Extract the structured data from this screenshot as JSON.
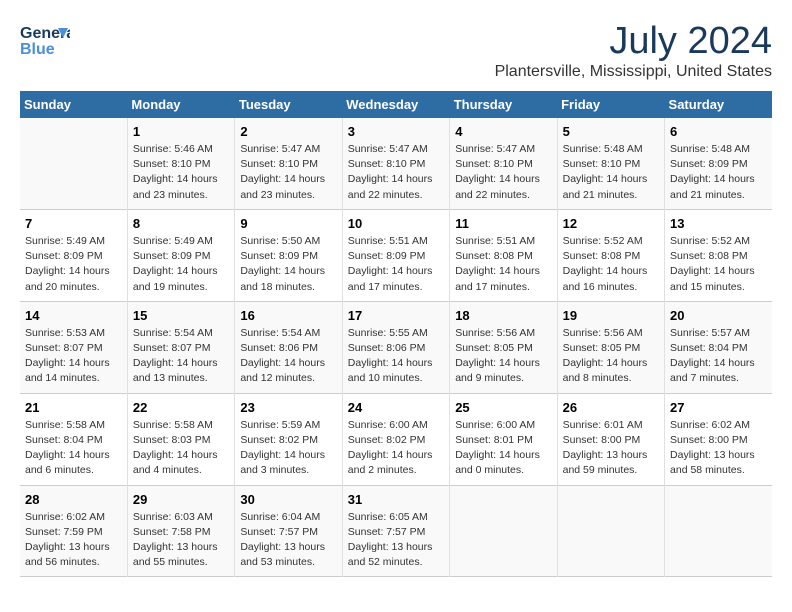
{
  "header": {
    "logo_line1": "General",
    "logo_line2": "Blue",
    "title": "July 2024",
    "subtitle": "Plantersville, Mississippi, United States"
  },
  "days_of_week": [
    "Sunday",
    "Monday",
    "Tuesday",
    "Wednesday",
    "Thursday",
    "Friday",
    "Saturday"
  ],
  "weeks": [
    [
      {
        "day": "",
        "content": ""
      },
      {
        "day": "1",
        "content": "Sunrise: 5:46 AM\nSunset: 8:10 PM\nDaylight: 14 hours\nand 23 minutes."
      },
      {
        "day": "2",
        "content": "Sunrise: 5:47 AM\nSunset: 8:10 PM\nDaylight: 14 hours\nand 23 minutes."
      },
      {
        "day": "3",
        "content": "Sunrise: 5:47 AM\nSunset: 8:10 PM\nDaylight: 14 hours\nand 22 minutes."
      },
      {
        "day": "4",
        "content": "Sunrise: 5:47 AM\nSunset: 8:10 PM\nDaylight: 14 hours\nand 22 minutes."
      },
      {
        "day": "5",
        "content": "Sunrise: 5:48 AM\nSunset: 8:10 PM\nDaylight: 14 hours\nand 21 minutes."
      },
      {
        "day": "6",
        "content": "Sunrise: 5:48 AM\nSunset: 8:09 PM\nDaylight: 14 hours\nand 21 minutes."
      }
    ],
    [
      {
        "day": "7",
        "content": "Sunrise: 5:49 AM\nSunset: 8:09 PM\nDaylight: 14 hours\nand 20 minutes."
      },
      {
        "day": "8",
        "content": "Sunrise: 5:49 AM\nSunset: 8:09 PM\nDaylight: 14 hours\nand 19 minutes."
      },
      {
        "day": "9",
        "content": "Sunrise: 5:50 AM\nSunset: 8:09 PM\nDaylight: 14 hours\nand 18 minutes."
      },
      {
        "day": "10",
        "content": "Sunrise: 5:51 AM\nSunset: 8:09 PM\nDaylight: 14 hours\nand 17 minutes."
      },
      {
        "day": "11",
        "content": "Sunrise: 5:51 AM\nSunset: 8:08 PM\nDaylight: 14 hours\nand 17 minutes."
      },
      {
        "day": "12",
        "content": "Sunrise: 5:52 AM\nSunset: 8:08 PM\nDaylight: 14 hours\nand 16 minutes."
      },
      {
        "day": "13",
        "content": "Sunrise: 5:52 AM\nSunset: 8:08 PM\nDaylight: 14 hours\nand 15 minutes."
      }
    ],
    [
      {
        "day": "14",
        "content": "Sunrise: 5:53 AM\nSunset: 8:07 PM\nDaylight: 14 hours\nand 14 minutes."
      },
      {
        "day": "15",
        "content": "Sunrise: 5:54 AM\nSunset: 8:07 PM\nDaylight: 14 hours\nand 13 minutes."
      },
      {
        "day": "16",
        "content": "Sunrise: 5:54 AM\nSunset: 8:06 PM\nDaylight: 14 hours\nand 12 minutes."
      },
      {
        "day": "17",
        "content": "Sunrise: 5:55 AM\nSunset: 8:06 PM\nDaylight: 14 hours\nand 10 minutes."
      },
      {
        "day": "18",
        "content": "Sunrise: 5:56 AM\nSunset: 8:05 PM\nDaylight: 14 hours\nand 9 minutes."
      },
      {
        "day": "19",
        "content": "Sunrise: 5:56 AM\nSunset: 8:05 PM\nDaylight: 14 hours\nand 8 minutes."
      },
      {
        "day": "20",
        "content": "Sunrise: 5:57 AM\nSunset: 8:04 PM\nDaylight: 14 hours\nand 7 minutes."
      }
    ],
    [
      {
        "day": "21",
        "content": "Sunrise: 5:58 AM\nSunset: 8:04 PM\nDaylight: 14 hours\nand 6 minutes."
      },
      {
        "day": "22",
        "content": "Sunrise: 5:58 AM\nSunset: 8:03 PM\nDaylight: 14 hours\nand 4 minutes."
      },
      {
        "day": "23",
        "content": "Sunrise: 5:59 AM\nSunset: 8:02 PM\nDaylight: 14 hours\nand 3 minutes."
      },
      {
        "day": "24",
        "content": "Sunrise: 6:00 AM\nSunset: 8:02 PM\nDaylight: 14 hours\nand 2 minutes."
      },
      {
        "day": "25",
        "content": "Sunrise: 6:00 AM\nSunset: 8:01 PM\nDaylight: 14 hours\nand 0 minutes."
      },
      {
        "day": "26",
        "content": "Sunrise: 6:01 AM\nSunset: 8:00 PM\nDaylight: 13 hours\nand 59 minutes."
      },
      {
        "day": "27",
        "content": "Sunrise: 6:02 AM\nSunset: 8:00 PM\nDaylight: 13 hours\nand 58 minutes."
      }
    ],
    [
      {
        "day": "28",
        "content": "Sunrise: 6:02 AM\nSunset: 7:59 PM\nDaylight: 13 hours\nand 56 minutes."
      },
      {
        "day": "29",
        "content": "Sunrise: 6:03 AM\nSunset: 7:58 PM\nDaylight: 13 hours\nand 55 minutes."
      },
      {
        "day": "30",
        "content": "Sunrise: 6:04 AM\nSunset: 7:57 PM\nDaylight: 13 hours\nand 53 minutes."
      },
      {
        "day": "31",
        "content": "Sunrise: 6:05 AM\nSunset: 7:57 PM\nDaylight: 13 hours\nand 52 minutes."
      },
      {
        "day": "",
        "content": ""
      },
      {
        "day": "",
        "content": ""
      },
      {
        "day": "",
        "content": ""
      }
    ]
  ]
}
